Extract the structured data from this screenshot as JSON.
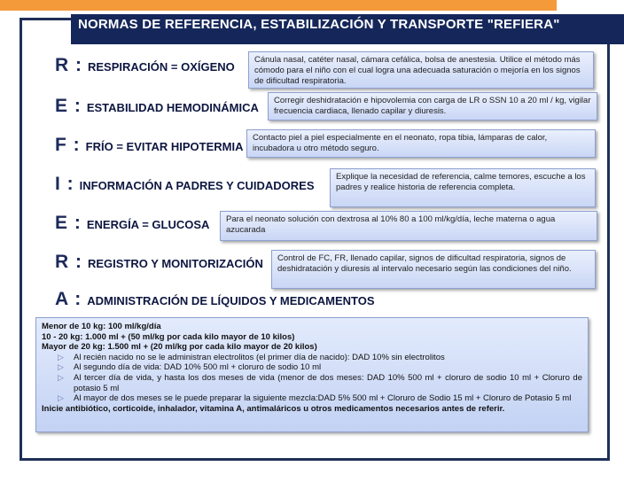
{
  "title": "NORMAS DE REFERENCIA, ESTABILIZACIÓN Y TRANSPORTE \"REFIERA\"",
  "rows": [
    {
      "letter": "R :",
      "heading": "RESPIRACIÓN = OXÍGENO",
      "text": "Cánula nasal, catéter nasal, cámara cefálica, bolsa de anestesia. Utilice el método más cómodo para el niño con el cual logra una adecuada saturación o mejoría en los signos de dificultad respiratoria."
    },
    {
      "letter": "E :",
      "heading": "ESTABILIDAD HEMODINÁMICA",
      "text": "Corregir deshidratación e hipovolemia con carga de LR o SSN 10 a 20 ml / kg, vigilar frecuencia cardiaca, llenado capilar y diuresis."
    },
    {
      "letter": "F :",
      "heading": "FRÍO = EVITAR HIPOTERMIA",
      "text": "Contacto piel a piel especialmente en el neonato, ropa tibia, lámparas de calor, incubadora u otro método seguro."
    },
    {
      "letter": "I :",
      "heading": "INFORMACIÓN A PADRES Y CUIDADORES",
      "text": "Explique la necesidad de referencia, calme temores, escuche a los padres y realice historia de referencia completa."
    },
    {
      "letter": "E :",
      "heading": "ENERGÍA = GLUCOSA",
      "text": "Para el neonato solución con dextrosa al 10% 80 a 100 ml/kg/día, leche materna o agua azucarada"
    },
    {
      "letter": "R :",
      "heading": "REGISTRO Y MONITORIZACIÓN",
      "text": "Control de FC, FR, llenado capilar, signos de dificultad respiratoria, signos de deshidratación y diuresis al intervalo necesario según las condiciones del niño."
    },
    {
      "letter": "A :",
      "heading": "ADMINISTRACIÓN DE LÍQUIDOS Y MEDICAMENTOS"
    }
  ],
  "fluids": {
    "line1": "Menor de 10 kg: 100 ml/kg/día",
    "line2": "10 - 20 kg: 1.000 ml + (50 ml/kg por cada kilo mayor de 10 kilos)",
    "line3": "Mayor de 20 kg: 1.500 ml + (20 ml/kg por cada kilo mayor de 20 kilos)",
    "bullets": [
      "Al recién nacido no se le administran electrolitos (el primer día de nacido): DAD 10% sin electrolitos",
      "Al segundo día de vida: DAD 10% 500 ml + cloruro de sodio 10 ml",
      "Al tercer día de vida, y hasta los dos meses de vida (menor de dos meses: DAD 10% 500 ml + cloruro de sodio 10 ml + Cloruro de potasio 5 ml",
      "Al mayor de dos meses se le puede preparar la siguiente mezcla:DAD 5% 500 ml + Cloruro de Sodio 15 ml + Cloruro de Potasio 5 ml"
    ],
    "footer": "Inicie antibiótico, corticoide, inhalador, vitamina A, antimaláricos u otros medicamentos necesarios antes de referir."
  },
  "colors": {
    "title_bar": "#15275a",
    "accent_orange": "#f59a3b",
    "frame": "#1f2f57",
    "box_fill": "#d3ddf7"
  }
}
